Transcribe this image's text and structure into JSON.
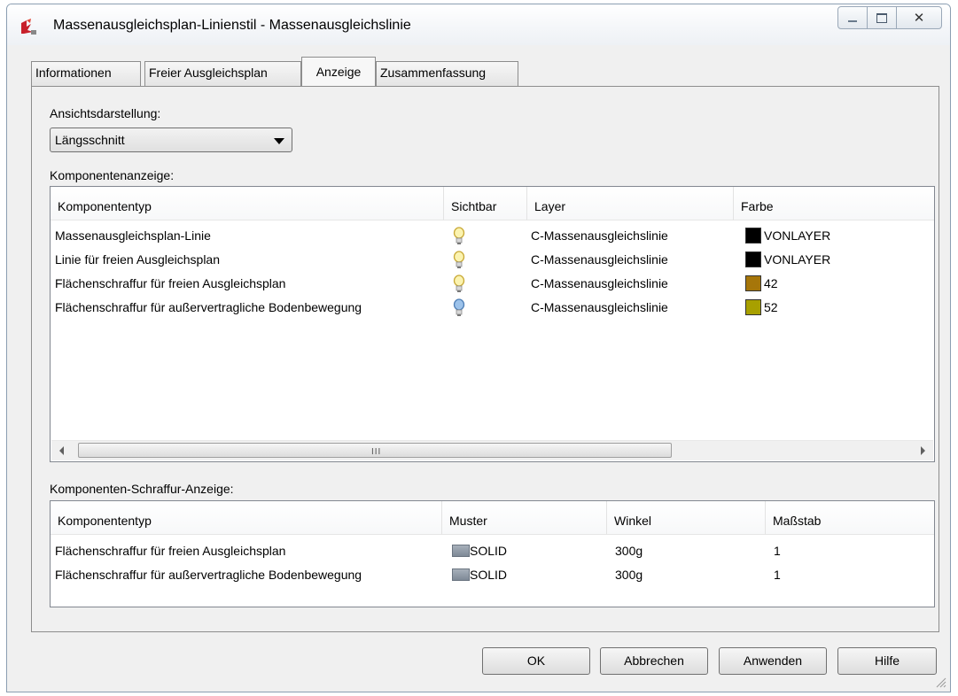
{
  "window": {
    "title": "Massenausgleichsplan-Linienstil - Massenausgleichslinie",
    "controls": {
      "minimize": "minimize",
      "maximize": "maximize",
      "close": "✕"
    }
  },
  "tabs": [
    {
      "label": "Informationen"
    },
    {
      "label": "Freier Ausgleichsplan"
    },
    {
      "label": "Anzeige"
    },
    {
      "label": "Zusammenfassung"
    }
  ],
  "active_tab": "Anzeige",
  "view": {
    "label": "Ansichtsdarstellung:",
    "selected": "Längsschnitt"
  },
  "component_display": {
    "label": "Komponentenanzeige:",
    "headers": {
      "type": "Komponententyp",
      "visible": "Sichtbar",
      "layer": "Layer",
      "color": "Farbe"
    },
    "rows": [
      {
        "type": "Massenausgleichsplan-Linie",
        "visible": "on",
        "layer": "C-Massenausgleichslinie",
        "color_label": "VONLAYER",
        "swatch": "#000000"
      },
      {
        "type": "Linie für freien Ausgleichsplan",
        "visible": "on",
        "layer": "C-Massenausgleichslinie",
        "color_label": "VONLAYER",
        "swatch": "#000000"
      },
      {
        "type": "Flächenschraffur für freien Ausgleichsplan",
        "visible": "on",
        "layer": "C-Massenausgleichslinie",
        "color_label": "42",
        "swatch": "#a6760a"
      },
      {
        "type": "Flächenschraffur für außervertragliche Bodenbewegung",
        "visible": "off",
        "layer": "C-Massenausgleichslinie",
        "color_label": "52",
        "swatch": "#a8a000"
      }
    ],
    "scrollbar_grip": "III"
  },
  "hatch_display": {
    "label": "Komponenten-Schraffur-Anzeige:",
    "headers": {
      "type": "Komponententyp",
      "pattern": "Muster",
      "angle": "Winkel",
      "scale": "Maßstab"
    },
    "rows": [
      {
        "type": "Flächenschraffur für freien Ausgleichsplan",
        "pattern": "SOLID",
        "angle": "300g",
        "scale": "1"
      },
      {
        "type": "Flächenschraffur für außervertragliche Bodenbewegung",
        "pattern": "SOLID",
        "angle": "300g",
        "scale": "1"
      }
    ]
  },
  "buttons": {
    "ok": "OK",
    "cancel": "Abbrechen",
    "apply": "Anwenden",
    "help": "Hilfe"
  },
  "colors": {
    "accent_bulb_on": "#f3e27a",
    "bulb_off": "#8fb6e0"
  }
}
